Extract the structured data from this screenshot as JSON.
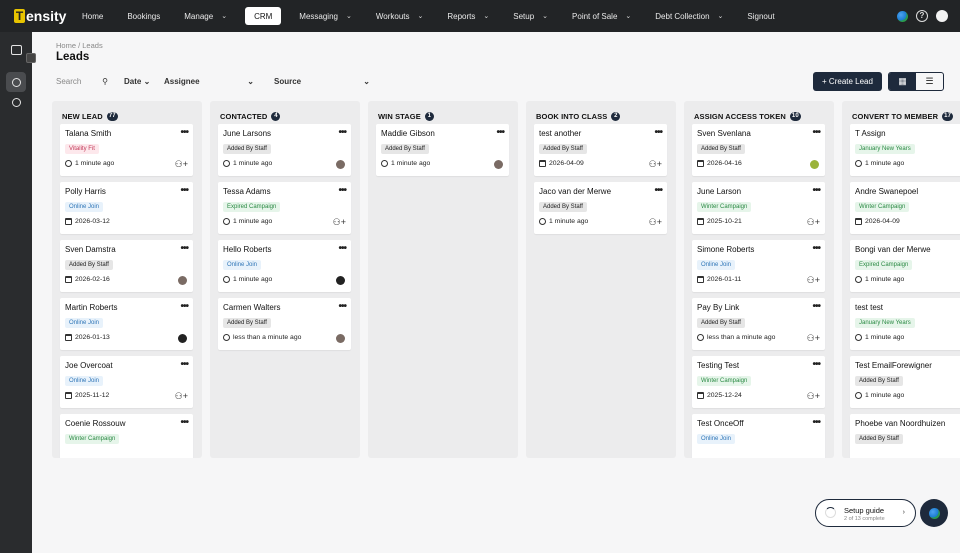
{
  "brand": {
    "logo_letter": "T",
    "logo_text": "ensity"
  },
  "nav": [
    {
      "label": "Home",
      "chevron": false
    },
    {
      "label": "Bookings",
      "chevron": false
    },
    {
      "label": "Manage",
      "chevron": true
    },
    {
      "label": "CRM",
      "chevron": false,
      "active": true
    },
    {
      "label": "Messaging",
      "chevron": true
    },
    {
      "label": "Workouts",
      "chevron": true
    },
    {
      "label": "Reports",
      "chevron": true
    },
    {
      "label": "Setup",
      "chevron": true
    },
    {
      "label": "Point of Sale",
      "chevron": true
    },
    {
      "label": "Debt Collection",
      "chevron": true
    },
    {
      "label": "Signout",
      "chevron": false
    }
  ],
  "nav_right": {
    "help": "?"
  },
  "breadcrumb": "Home / Leads",
  "page_title": "Leads",
  "filters": {
    "search_placeholder": "Search",
    "date": "Date",
    "assignee": "Assignee",
    "source": "Source"
  },
  "create_button": "+ Create Lead",
  "columns": [
    {
      "title": "NEW LEAD",
      "count": "77",
      "cards": [
        {
          "name": "Talana Smith",
          "tag": "Vitality Fit",
          "tag_style": "pink",
          "meta_icon": "clock",
          "meta": "1 minute ago",
          "right": "assign"
        },
        {
          "name": "Polly Harris",
          "tag": "Online Join",
          "tag_style": "blue",
          "meta_icon": "cal",
          "meta": "2026-03-12",
          "right": ""
        },
        {
          "name": "Sven Damstra",
          "tag": "Added By Staff",
          "tag_style": "gray",
          "meta_icon": "cal",
          "meta": "2026-02-16",
          "right": "avatar"
        },
        {
          "name": "Martin Roberts",
          "tag": "Online Join",
          "tag_style": "blue",
          "meta_icon": "cal",
          "meta": "2026-01-13",
          "right": "avatar-dark"
        },
        {
          "name": "Joe Overcoat",
          "tag": "Online Join",
          "tag_style": "blue",
          "meta_icon": "cal",
          "meta": "2025-11-12",
          "right": "assign"
        },
        {
          "name": "Coenie Rossouw",
          "tag": "Winter Campaign",
          "tag_style": "green",
          "meta_icon": "",
          "meta": "",
          "right": ""
        }
      ]
    },
    {
      "title": "CONTACTED",
      "count": "4",
      "cards": [
        {
          "name": "June Larsons",
          "tag": "Added By Staff",
          "tag_style": "gray",
          "meta_icon": "clock",
          "meta": "1 minute ago",
          "right": "avatar"
        },
        {
          "name": "Tessa Adams",
          "tag": "Expired Campaign",
          "tag_style": "green",
          "meta_icon": "clock",
          "meta": "1 minute ago",
          "right": "assign"
        },
        {
          "name": "Hello Roberts",
          "tag": "Online Join",
          "tag_style": "blue",
          "meta_icon": "clock",
          "meta": "1 minute ago",
          "right": "avatar-dark"
        },
        {
          "name": "Carmen Walters",
          "tag": "Added By Staff",
          "tag_style": "gray",
          "meta_icon": "clock",
          "meta": "less than a minute ago",
          "right": "avatar"
        }
      ]
    },
    {
      "title": "WIN STAGE",
      "count": "1",
      "cards": [
        {
          "name": "Maddie Gibson",
          "tag": "Added By Staff",
          "tag_style": "gray",
          "meta_icon": "clock",
          "meta": "1 minute ago",
          "right": "avatar"
        }
      ]
    },
    {
      "title": "BOOK INTO CLASS",
      "count": "2",
      "cards": [
        {
          "name": "test another",
          "tag": "Added By Staff",
          "tag_style": "gray",
          "meta_icon": "cal",
          "meta": "2026-04-09",
          "right": "assign"
        },
        {
          "name": "Jaco van der Merwe",
          "tag": "Added By Staff",
          "tag_style": "gray",
          "meta_icon": "clock",
          "meta": "1 minute ago",
          "right": "assign"
        }
      ]
    },
    {
      "title": "ASSIGN ACCESS TOKEN",
      "count": "10",
      "cards": [
        {
          "name": "Sven Svenlana",
          "tag": "Added By Staff",
          "tag_style": "gray",
          "meta_icon": "cal",
          "meta": "2026-04-16",
          "right": "avatar-green"
        },
        {
          "name": "June Larson",
          "tag": "Winter Campaign",
          "tag_style": "green",
          "meta_icon": "cal",
          "meta": "2025-10-21",
          "right": "assign"
        },
        {
          "name": "Simone Roberts",
          "tag": "Online Join",
          "tag_style": "blue",
          "meta_icon": "cal",
          "meta": "2026-01-11",
          "right": "assign"
        },
        {
          "name": "Pay By Link",
          "tag": "Added By Staff",
          "tag_style": "gray",
          "meta_icon": "clock",
          "meta": "less than a minute ago",
          "right": "assign"
        },
        {
          "name": "Testing Test",
          "tag": "Winter Campaign",
          "tag_style": "green",
          "meta_icon": "cal",
          "meta": "2025-12-24",
          "right": "assign"
        },
        {
          "name": "Test OnceOff",
          "tag": "Online Join",
          "tag_style": "blue",
          "meta_icon": "",
          "meta": "",
          "right": ""
        }
      ]
    },
    {
      "title": "CONVERT TO MEMBER",
      "count": "17",
      "cards": [
        {
          "name": "T Assign",
          "tag": "January New Years",
          "tag_style": "green",
          "meta_icon": "clock",
          "meta": "1 minute ago",
          "right": ""
        },
        {
          "name": "Andre Swanepoel",
          "tag": "Winter Campaign",
          "tag_style": "green",
          "meta_icon": "cal",
          "meta": "2026-04-09",
          "right": ""
        },
        {
          "name": "Bongi van der Merwe",
          "tag": "Expired Campaign",
          "tag_style": "green",
          "meta_icon": "clock",
          "meta": "1 minute ago",
          "right": ""
        },
        {
          "name": "test test",
          "tag": "January New Years",
          "tag_style": "green",
          "meta_icon": "clock",
          "meta": "1 minute ago",
          "right": ""
        },
        {
          "name": "Test EmailForewigner",
          "tag": "Added By Staff",
          "tag_style": "gray",
          "meta_icon": "clock",
          "meta": "1 minute ago",
          "right": ""
        },
        {
          "name": "Phoebe van Noordhuizen",
          "tag": "Added By Staff",
          "tag_style": "gray",
          "meta_icon": "",
          "meta": "",
          "right": ""
        }
      ]
    }
  ],
  "setup_guide": {
    "title": "Setup guide",
    "subtitle": "2 of 13 complete"
  },
  "colors": {
    "nav_bg": "#222426",
    "accent_dark": "#1e2a3c",
    "brand_yellow": "#e8c400"
  },
  "icons": [
    "home-icon",
    "search-icon",
    "list-view-icon",
    "board-view-icon",
    "more-icon",
    "assign-user-icon",
    "clock-icon",
    "calendar-icon",
    "globe-icon",
    "help-icon"
  ]
}
